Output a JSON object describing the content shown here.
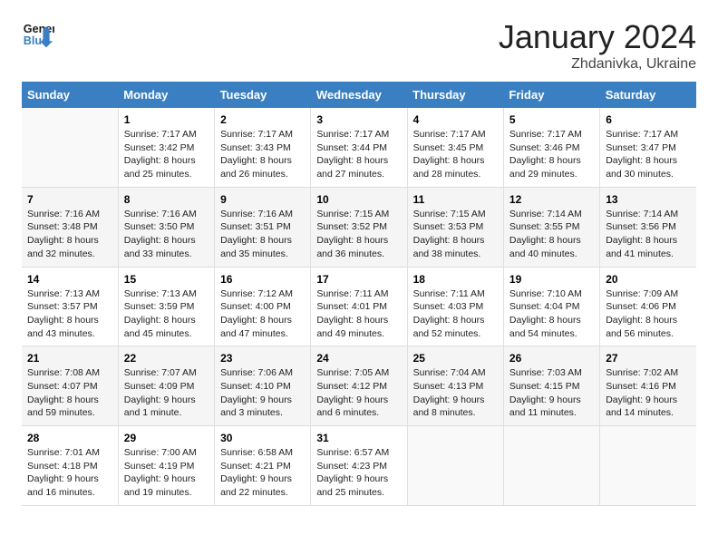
{
  "header": {
    "logo_line1": "General",
    "logo_line2": "Blue",
    "title": "January 2024",
    "subtitle": "Zhdanivka, Ukraine"
  },
  "columns": [
    "Sunday",
    "Monday",
    "Tuesday",
    "Wednesday",
    "Thursday",
    "Friday",
    "Saturday"
  ],
  "weeks": [
    [
      {
        "day": "",
        "info": ""
      },
      {
        "day": "1",
        "info": "Sunrise: 7:17 AM\nSunset: 3:42 PM\nDaylight: 8 hours\nand 25 minutes."
      },
      {
        "day": "2",
        "info": "Sunrise: 7:17 AM\nSunset: 3:43 PM\nDaylight: 8 hours\nand 26 minutes."
      },
      {
        "day": "3",
        "info": "Sunrise: 7:17 AM\nSunset: 3:44 PM\nDaylight: 8 hours\nand 27 minutes."
      },
      {
        "day": "4",
        "info": "Sunrise: 7:17 AM\nSunset: 3:45 PM\nDaylight: 8 hours\nand 28 minutes."
      },
      {
        "day": "5",
        "info": "Sunrise: 7:17 AM\nSunset: 3:46 PM\nDaylight: 8 hours\nand 29 minutes."
      },
      {
        "day": "6",
        "info": "Sunrise: 7:17 AM\nSunset: 3:47 PM\nDaylight: 8 hours\nand 30 minutes."
      }
    ],
    [
      {
        "day": "7",
        "info": "Sunrise: 7:16 AM\nSunset: 3:48 PM\nDaylight: 8 hours\nand 32 minutes."
      },
      {
        "day": "8",
        "info": "Sunrise: 7:16 AM\nSunset: 3:50 PM\nDaylight: 8 hours\nand 33 minutes."
      },
      {
        "day": "9",
        "info": "Sunrise: 7:16 AM\nSunset: 3:51 PM\nDaylight: 8 hours\nand 35 minutes."
      },
      {
        "day": "10",
        "info": "Sunrise: 7:15 AM\nSunset: 3:52 PM\nDaylight: 8 hours\nand 36 minutes."
      },
      {
        "day": "11",
        "info": "Sunrise: 7:15 AM\nSunset: 3:53 PM\nDaylight: 8 hours\nand 38 minutes."
      },
      {
        "day": "12",
        "info": "Sunrise: 7:14 AM\nSunset: 3:55 PM\nDaylight: 8 hours\nand 40 minutes."
      },
      {
        "day": "13",
        "info": "Sunrise: 7:14 AM\nSunset: 3:56 PM\nDaylight: 8 hours\nand 41 minutes."
      }
    ],
    [
      {
        "day": "14",
        "info": "Sunrise: 7:13 AM\nSunset: 3:57 PM\nDaylight: 8 hours\nand 43 minutes."
      },
      {
        "day": "15",
        "info": "Sunrise: 7:13 AM\nSunset: 3:59 PM\nDaylight: 8 hours\nand 45 minutes."
      },
      {
        "day": "16",
        "info": "Sunrise: 7:12 AM\nSunset: 4:00 PM\nDaylight: 8 hours\nand 47 minutes."
      },
      {
        "day": "17",
        "info": "Sunrise: 7:11 AM\nSunset: 4:01 PM\nDaylight: 8 hours\nand 49 minutes."
      },
      {
        "day": "18",
        "info": "Sunrise: 7:11 AM\nSunset: 4:03 PM\nDaylight: 8 hours\nand 52 minutes."
      },
      {
        "day": "19",
        "info": "Sunrise: 7:10 AM\nSunset: 4:04 PM\nDaylight: 8 hours\nand 54 minutes."
      },
      {
        "day": "20",
        "info": "Sunrise: 7:09 AM\nSunset: 4:06 PM\nDaylight: 8 hours\nand 56 minutes."
      }
    ],
    [
      {
        "day": "21",
        "info": "Sunrise: 7:08 AM\nSunset: 4:07 PM\nDaylight: 8 hours\nand 59 minutes."
      },
      {
        "day": "22",
        "info": "Sunrise: 7:07 AM\nSunset: 4:09 PM\nDaylight: 9 hours\nand 1 minute."
      },
      {
        "day": "23",
        "info": "Sunrise: 7:06 AM\nSunset: 4:10 PM\nDaylight: 9 hours\nand 3 minutes."
      },
      {
        "day": "24",
        "info": "Sunrise: 7:05 AM\nSunset: 4:12 PM\nDaylight: 9 hours\nand 6 minutes."
      },
      {
        "day": "25",
        "info": "Sunrise: 7:04 AM\nSunset: 4:13 PM\nDaylight: 9 hours\nand 8 minutes."
      },
      {
        "day": "26",
        "info": "Sunrise: 7:03 AM\nSunset: 4:15 PM\nDaylight: 9 hours\nand 11 minutes."
      },
      {
        "day": "27",
        "info": "Sunrise: 7:02 AM\nSunset: 4:16 PM\nDaylight: 9 hours\nand 14 minutes."
      }
    ],
    [
      {
        "day": "28",
        "info": "Sunrise: 7:01 AM\nSunset: 4:18 PM\nDaylight: 9 hours\nand 16 minutes."
      },
      {
        "day": "29",
        "info": "Sunrise: 7:00 AM\nSunset: 4:19 PM\nDaylight: 9 hours\nand 19 minutes."
      },
      {
        "day": "30",
        "info": "Sunrise: 6:58 AM\nSunset: 4:21 PM\nDaylight: 9 hours\nand 22 minutes."
      },
      {
        "day": "31",
        "info": "Sunrise: 6:57 AM\nSunset: 4:23 PM\nDaylight: 9 hours\nand 25 minutes."
      },
      {
        "day": "",
        "info": ""
      },
      {
        "day": "",
        "info": ""
      },
      {
        "day": "",
        "info": ""
      }
    ]
  ]
}
